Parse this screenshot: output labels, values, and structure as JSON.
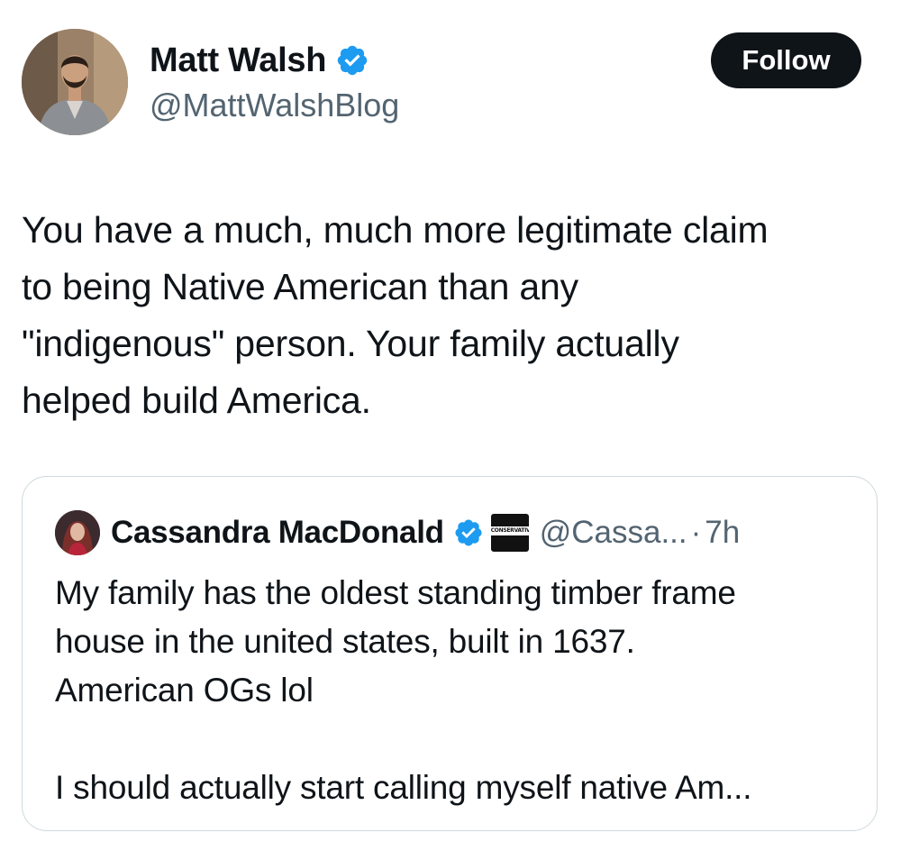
{
  "tweet": {
    "author": {
      "name": "Matt Walsh",
      "handle": "@MattWalshBlog",
      "verified": true,
      "avatar_icon": "profile-photo-man-with-beard"
    },
    "follow_label": "Follow",
    "text": "You have a much, much more legitimate claim\nto being Native American than any\n\"indigenous\" person. Your family actually\nhelped build America."
  },
  "quoted_tweet": {
    "author": {
      "name": "Cassandra MacDonald",
      "handle": "@Cassa...",
      "verified": true,
      "affiliate_badge_text": "CONSERVATIVE",
      "avatar_icon": "profile-photo-woman"
    },
    "separator": "·",
    "time": "7h",
    "text": "My family has the oldest standing timber frame\nhouse in the united states, built in 1637.\nAmerican OGs lol\n\nI should actually start calling myself native Am..."
  },
  "colors": {
    "text_primary": "#0f1419",
    "text_secondary": "#536471",
    "verified_blue": "#1d9bf0",
    "follow_button_bg": "#0f1419",
    "border": "#cfd9de"
  }
}
